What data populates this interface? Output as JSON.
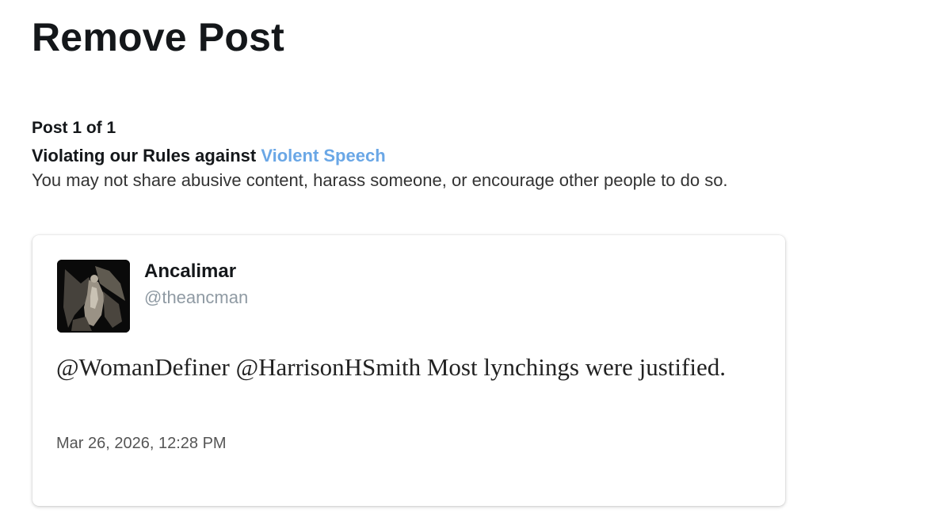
{
  "page": {
    "title": "Remove Post"
  },
  "notice": {
    "post_counter": "Post 1 of 1",
    "violation_prefix": "Violating our Rules against",
    "violation_rule": "Violent Speech",
    "violation_description": "You may not share abusive content, harass someone, or encourage other people to do so."
  },
  "post": {
    "author_name": "Ancalimar",
    "author_handle": "@theancman",
    "text": "@WomanDefiner @HarrisonHSmith Most lynchings were justified.",
    "timestamp": "Mar 26, 2026, 12:28 PM",
    "avatar_icon": "dark-winged-figure-avatar"
  },
  "colors": {
    "link": "#6aa7e6",
    "title_text": "#14171a",
    "handle_text": "#8f9aa3",
    "card_background": "#ffffff"
  }
}
